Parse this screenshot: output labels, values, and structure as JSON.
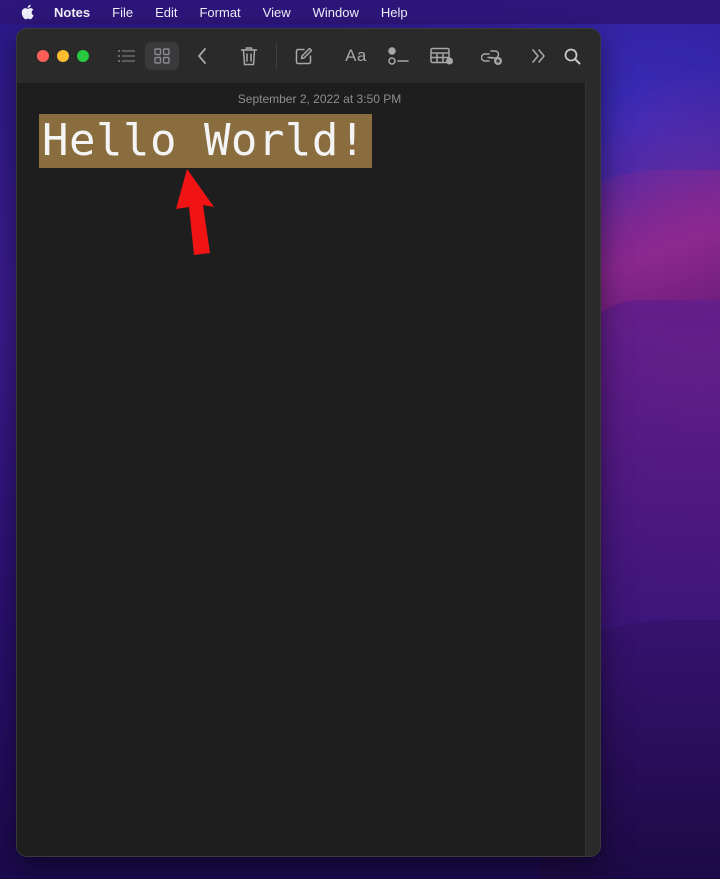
{
  "menubar": {
    "apple_icon": "apple-logo",
    "items": [
      "Notes",
      "File",
      "Edit",
      "Format",
      "View",
      "Window",
      "Help"
    ]
  },
  "toolbar": {
    "icons": [
      "list-view-icon",
      "gallery-view-icon",
      "back-chevron-icon",
      "trash-icon",
      "compose-icon",
      "text-format-icon",
      "checklist-icon",
      "table-icon",
      "share-collaborate-icon",
      "more-chevrons-icon",
      "search-icon"
    ],
    "format_label": "Aa"
  },
  "note": {
    "timestamp": "September 2, 2022 at 3:50 PM",
    "text": "Hello World!",
    "highlight_color": "#8a6d3f"
  },
  "annotation": {
    "arrow_color": "#f01414"
  }
}
